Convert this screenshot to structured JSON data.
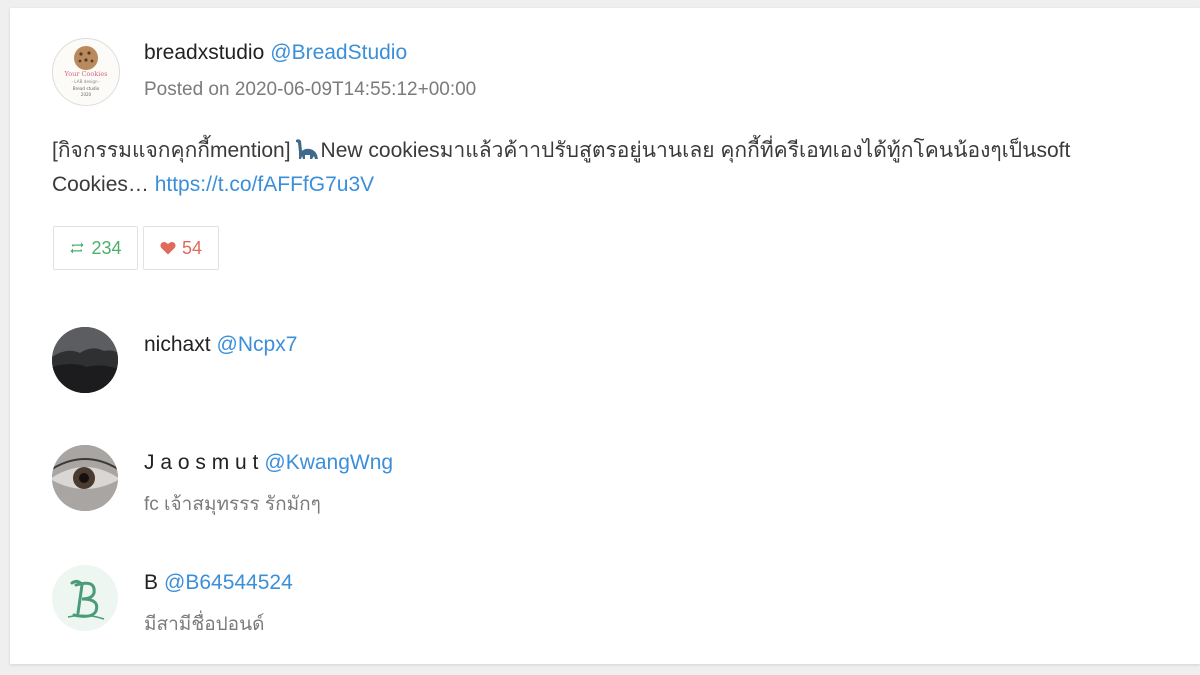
{
  "tweet": {
    "display_name": "breadxstudio",
    "handle": "@BreadStudio",
    "posted": "Posted on 2020-06-09T14:55:12+00:00",
    "text_part1": "[กิจกรรมแจกคุกกี้mention]",
    "text_part2": "New cookiesมาแล้วค้าาปรับสูตรอยู่นานเลย คุกกี้ที่ครีเอทเองได้ทู้กโคนน้องๆเป็นsoft Cookies… ",
    "link": "https://t.co/fAFFfG7u3V",
    "emoji_icon": "dinosaur-icon",
    "retweets": "234",
    "likes": "54",
    "avatar_text": [
      "Your Cookies",
      "- LAB design -",
      "Bread studio",
      "2020"
    ]
  },
  "users": [
    {
      "display_name": "nichaxt",
      "handle": "@Ncpx7",
      "bio": ""
    },
    {
      "display_name": "J a o s m u t",
      "handle": "@KwangWng",
      "bio": "fc เจ้าสมุทรรร รักมักๆ"
    },
    {
      "display_name": "B",
      "handle": "@B64544524",
      "bio": "มีสามีชื่อปอนด์"
    }
  ],
  "colors": {
    "link": "#3b8fd9",
    "retweet": "#4caf6a",
    "like": "#e06a5c"
  }
}
